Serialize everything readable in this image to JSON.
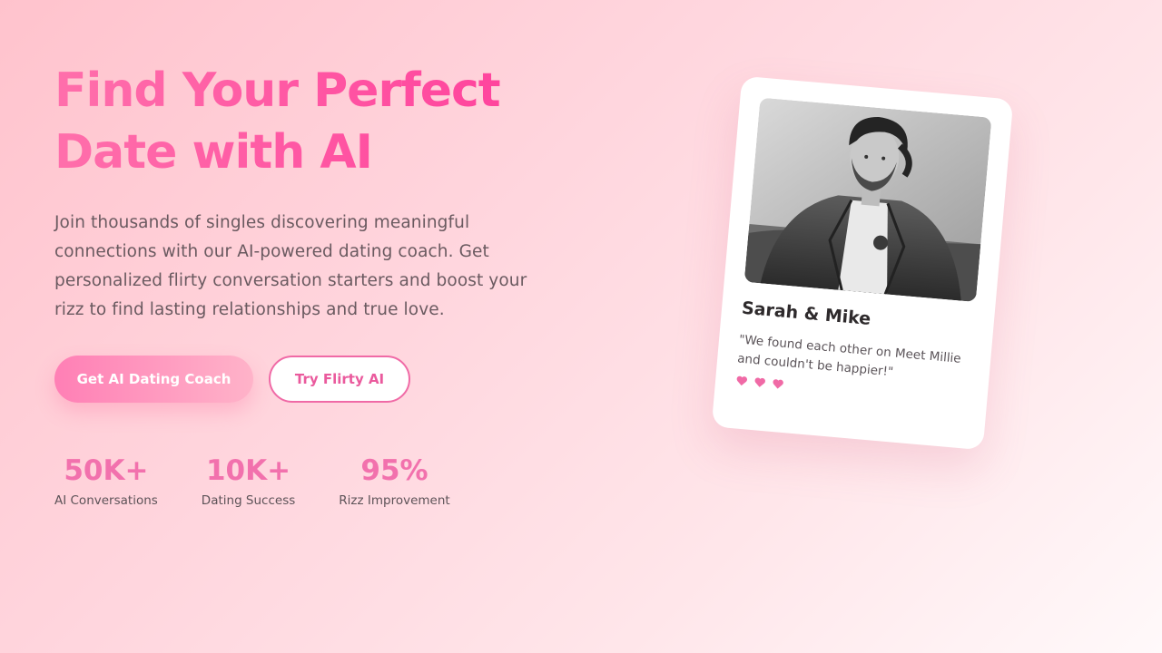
{
  "hero": {
    "title_line1": "Find Your Perfect",
    "title_line2": "Date with AI",
    "subtitle": "Join thousands of singles discovering meaningful connections with our AI-powered dating coach. Get personalized flirty conversation starters and boost your rizz to find lasting relationships and true love.",
    "primary_cta": "Get AI Dating Coach",
    "secondary_cta": "Try Flirty AI"
  },
  "stats": [
    {
      "value": "50K+",
      "label": "AI Conversations"
    },
    {
      "value": "10K+",
      "label": "Dating Success"
    },
    {
      "value": "95%",
      "label": "Rizz Improvement"
    }
  ],
  "testimonial": {
    "name": "Sarah & Mike",
    "quote": "\"We found each other on Meet Millie and couldn't be happier!\"",
    "hearts": 3,
    "photo_icon": "person-portrait-photo"
  },
  "colors": {
    "accent": "#f271ad",
    "title_gradient_start": "#ff6fab",
    "title_gradient_end": "#ff3b9a",
    "button_gradient_start": "#ff7fb5",
    "button_gradient_end": "#ffb3c9",
    "heart": "#f06aa6"
  }
}
